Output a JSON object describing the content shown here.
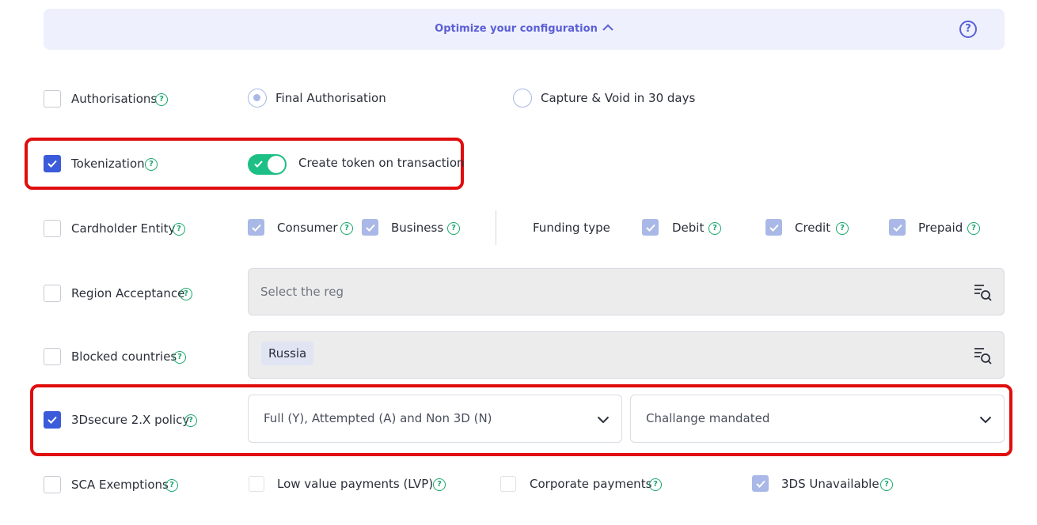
{
  "banner": {
    "title": "Optimize your configuration",
    "help": "?"
  },
  "help_glyph": "?",
  "authorisations": {
    "label": "Authorisations",
    "options": [
      "Final Authorisation",
      "Capture & Void in 30 days"
    ]
  },
  "tokenization": {
    "label": "Tokenization",
    "toggle_label": "Create token on transaction"
  },
  "cardholder": {
    "label": "Cardholder Entity",
    "consumer": "Consumer",
    "business": "Business",
    "funding_label": "Funding type",
    "debit": "Debit",
    "credit": "Credit",
    "prepaid": "Prepaid"
  },
  "region": {
    "label": "Region Acceptance",
    "placeholder": "Select the reg"
  },
  "blocked": {
    "label": "Blocked countries",
    "chip": "Russia"
  },
  "threeds": {
    "label": "3Dsecure 2.X policy",
    "policy_value": "Full (Y), Attempted (A) and Non 3D (N)",
    "challenge_value": "Challange mandated"
  },
  "sca": {
    "label": "SCA Exemptions",
    "lvp": "Low value payments (LVP)",
    "corporate": "Corporate payments",
    "unavailable": "3DS Unavailable"
  },
  "colors": {
    "accent": "#3b5bdb",
    "banner_text": "#5b5fd6",
    "help_green": "#1aa86b",
    "toggle_green": "#1dbf84",
    "highlight_red": "#e00d0d"
  }
}
